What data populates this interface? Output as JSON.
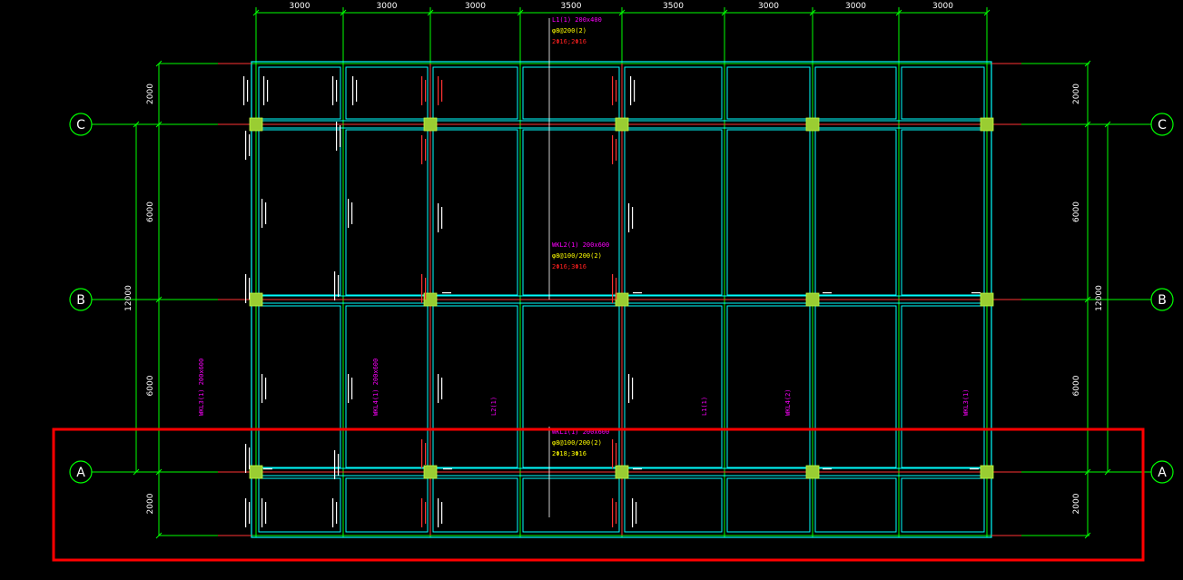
{
  "colors": {
    "background": "#000000",
    "grid": "#00ff00",
    "beam_outline": "#00ffff",
    "beam_center": "#ff3333",
    "column_fill": "#9acd32",
    "annotation_magenta": "#ff00ff",
    "annotation_yellow": "#ffff00",
    "annotation_red": "#ff2020",
    "annotation_white": "#ffffff",
    "highlight_box": "#ff0000"
  },
  "top_dimensions": [
    "3000",
    "3000",
    "3000",
    "3500",
    "3500",
    "3000",
    "3000",
    "3000"
  ],
  "left_dimensions": [
    "2000",
    "6000",
    "6000",
    "2000"
  ],
  "right_dimensions": [
    "2000",
    "6000",
    "6000",
    "2000"
  ],
  "overall_dimension_left": "12000",
  "overall_dimension_right": "12000",
  "axis_labels": {
    "left": [
      "C",
      "B",
      "A"
    ],
    "right": [
      "C",
      "B",
      "A"
    ]
  },
  "annotations": [
    {
      "text": "L1(1) 200x400",
      "color": "magenta"
    },
    {
      "text": "φ8@200(2)",
      "color": "yellow"
    },
    {
      "text": "2Φ16;2Φ16",
      "color": "red"
    },
    {
      "text": "WKL2(1) 200x600",
      "color": "magenta"
    },
    {
      "text": "φ8@100/200(2)",
      "color": "yellow"
    },
    {
      "text": "2Φ16;3Φ16",
      "color": "red"
    },
    {
      "text": "WKL1(1) 200x600",
      "color": "magenta"
    },
    {
      "text": "φ8@100/200(2)",
      "color": "yellow"
    },
    {
      "text": "2Φ18;3Φ16",
      "color": "yellow"
    },
    {
      "text": "WKL3(1) 200x600",
      "color": "magenta"
    },
    {
      "text": "WKL4(1) 200x600",
      "color": "magenta"
    },
    {
      "text": "L2(1)",
      "color": "magenta"
    },
    {
      "text": "L1(1)",
      "color": "magenta"
    },
    {
      "text": "WKL4(2)",
      "color": "magenta"
    },
    {
      "text": "WKL3(1)",
      "color": "magenta"
    }
  ]
}
